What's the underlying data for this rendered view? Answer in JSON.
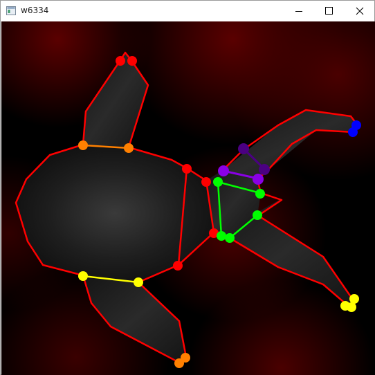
{
  "window": {
    "title": "w6334",
    "icon": "app-window-icon",
    "controls": [
      "minimize-icon",
      "maximize-icon",
      "close-icon"
    ]
  },
  "canvas": {
    "background_color": "#000000",
    "glow_color": "#5a0000",
    "silhouette_color": "#1c1c1c",
    "outline_color": "#ff0000",
    "keypoint_groups": [
      {
        "name": "head",
        "color": "#ff0000"
      },
      {
        "name": "upper-limb-orange",
        "color": "#ff8000"
      },
      {
        "name": "hind-limb-yellow",
        "color": "#ffff00"
      },
      {
        "name": "tail-blue",
        "color": "#0000ff"
      },
      {
        "name": "tail-indigo",
        "color": "#4b0082"
      },
      {
        "name": "tail-violet",
        "color": "#8a00e6"
      },
      {
        "name": "leg-green",
        "color": "#00ff00"
      }
    ]
  }
}
